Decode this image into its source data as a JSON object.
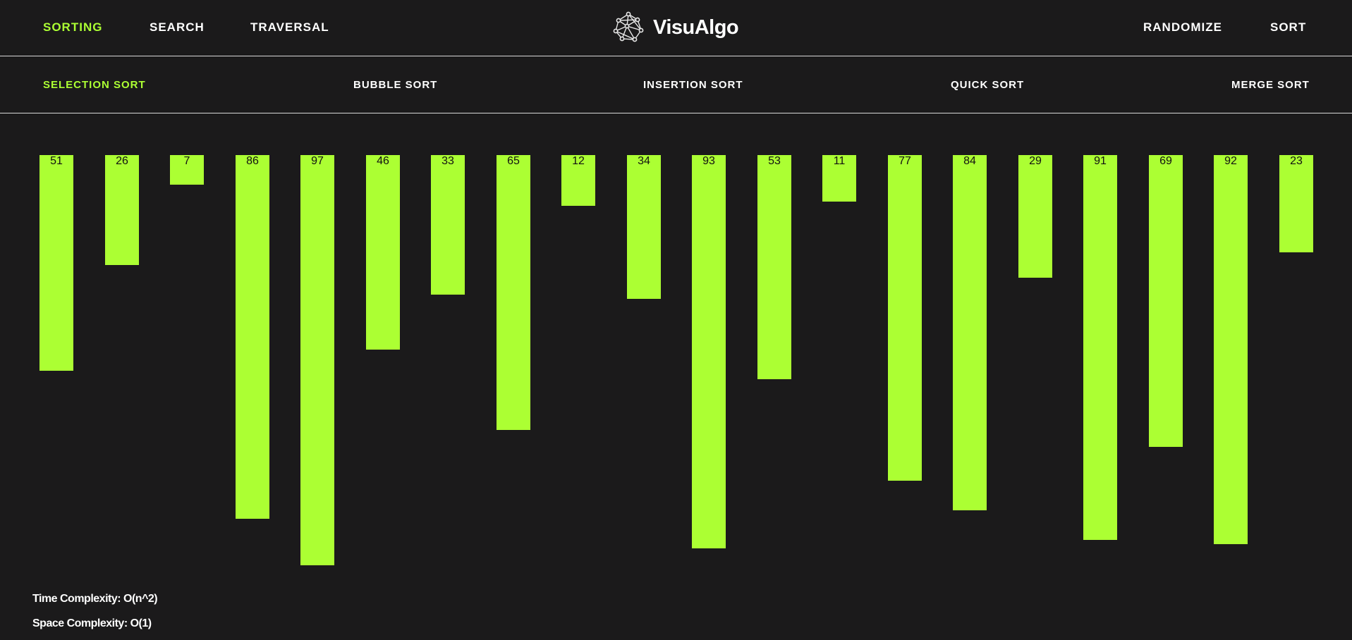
{
  "header": {
    "nav": [
      {
        "label": "SORTING",
        "active": true
      },
      {
        "label": "SEARCH",
        "active": false
      },
      {
        "label": "TRAVERSAL",
        "active": false
      }
    ],
    "brand": {
      "title": "VisuAlgo",
      "logo_icon": "network-graph-icon"
    },
    "actions": {
      "randomize": "RANDOMIZE",
      "sort": "SORT"
    }
  },
  "algorithms": [
    {
      "label": "SELECTION SORT",
      "active": true
    },
    {
      "label": "BUBBLE SORT",
      "active": false
    },
    {
      "label": "INSERTION SORT",
      "active": false
    },
    {
      "label": "QUICK SORT",
      "active": false
    },
    {
      "label": "MERGE SORT",
      "active": false
    }
  ],
  "array": {
    "values": [
      51,
      26,
      7,
      86,
      97,
      46,
      33,
      65,
      12,
      34,
      93,
      53,
      11,
      77,
      84,
      29,
      91,
      69,
      92,
      23
    ]
  },
  "complexity": {
    "time": "Time Complexity: O(n^2)",
    "space": "Space Complexity: O(1)"
  },
  "colors": {
    "accent": "#acff33",
    "background": "#1b1a1b",
    "text": "#ffffff"
  }
}
